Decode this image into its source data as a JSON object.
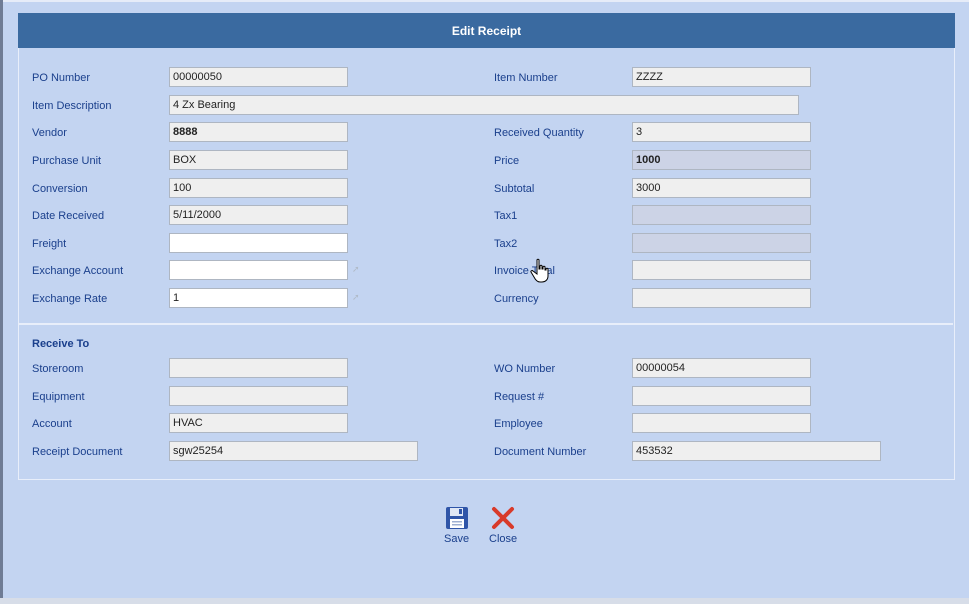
{
  "dialog": {
    "title": "Edit Receipt"
  },
  "left_fields": [
    {
      "label": "PO Number",
      "value": "00000050"
    },
    {
      "label": "Item Description",
      "value": "4 Zx Bearing"
    },
    {
      "label": "Vendor",
      "value": "8888"
    },
    {
      "label": "Purchase Unit",
      "value": "BOX"
    },
    {
      "label": "Conversion",
      "value": "100"
    },
    {
      "label": "Date Received",
      "value": "5/11/2000"
    },
    {
      "label": "Freight",
      "value": ""
    },
    {
      "label": "Exchange Account",
      "value": ""
    },
    {
      "label": "Exchange Rate",
      "value": "1"
    }
  ],
  "right_fields": [
    {
      "label": "Item Number",
      "value": "ZZZZ"
    },
    {
      "label": "Received Quantity",
      "value": "3"
    },
    {
      "label": "Price",
      "value": "1000"
    },
    {
      "label": "Subtotal",
      "value": "3000"
    },
    {
      "label": "Tax1",
      "value": ""
    },
    {
      "label": "Tax2",
      "value": ""
    },
    {
      "label": "Invoice Total",
      "value": ""
    },
    {
      "label": "Currency",
      "value": ""
    }
  ],
  "receive_to": {
    "title": "Receive To",
    "left": [
      {
        "label": "Storeroom",
        "value": ""
      },
      {
        "label": "Equipment",
        "value": ""
      },
      {
        "label": "Account",
        "value": "HVAC"
      },
      {
        "label": "Receipt Document",
        "value": "sgw25254"
      }
    ],
    "right": [
      {
        "label": "WO Number",
        "value": "00000054"
      },
      {
        "label": "Request #",
        "value": ""
      },
      {
        "label": "Employee",
        "value": ""
      },
      {
        "label": "Document Number",
        "value": "453532"
      }
    ]
  },
  "actions": {
    "save_label": "Save",
    "close_label": "Close"
  },
  "icons": {
    "save": "floppy-disk-icon",
    "close": "red-x-icon",
    "lookup": "lookup-icon",
    "cursor": "hand-cursor-icon"
  },
  "colors": {
    "background": "#c3d4f1",
    "header": "#3a6aa0",
    "label_text": "#1a3f8c",
    "close_red": "#d83a2a",
    "save_blue": "#2f55a8"
  }
}
